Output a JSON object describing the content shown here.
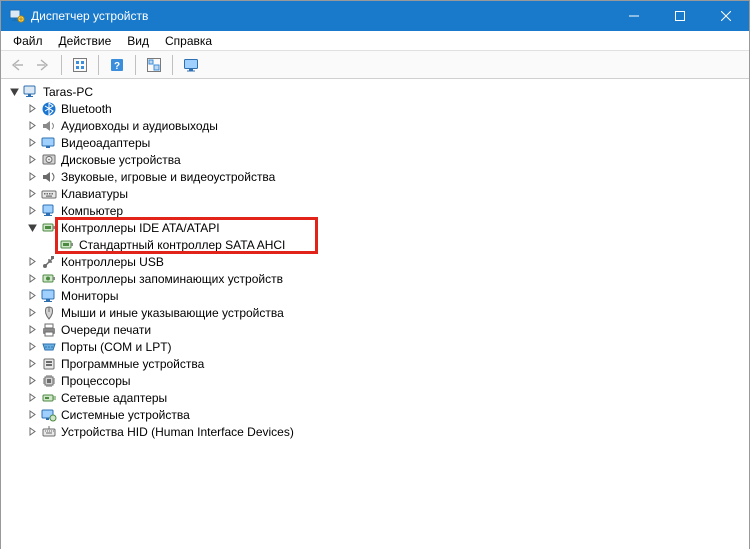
{
  "window": {
    "title": "Диспетчер устройств"
  },
  "menu": {
    "file": "Файл",
    "action": "Действие",
    "view": "Вид",
    "help": "Справка"
  },
  "tree": {
    "root": "Taras-PC",
    "bluetooth": "Bluetooth",
    "audio": "Аудиовходы и аудиовыходы",
    "video": "Видеоадаптеры",
    "disks": "Дисковые устройства",
    "sound": "Звуковые, игровые и видеоустройства",
    "keyboards": "Клавиатуры",
    "computer": "Компьютер",
    "ide": "Контроллеры IDE ATA/ATAPI",
    "sata_ahci": "Стандартный контроллер SATA AHCI",
    "usb": "Контроллеры USB",
    "storage_ctrl": "Контроллеры запоминающих устройств",
    "monitors": "Мониторы",
    "mice": "Мыши и иные указывающие устройства",
    "printq": "Очереди печати",
    "ports": "Порты (COM и LPT)",
    "software": "Программные устройства",
    "cpus": "Процессоры",
    "netadapters": "Сетевые адаптеры",
    "system": "Системные устройства",
    "hid": "Устройства HID (Human Interface Devices)"
  }
}
